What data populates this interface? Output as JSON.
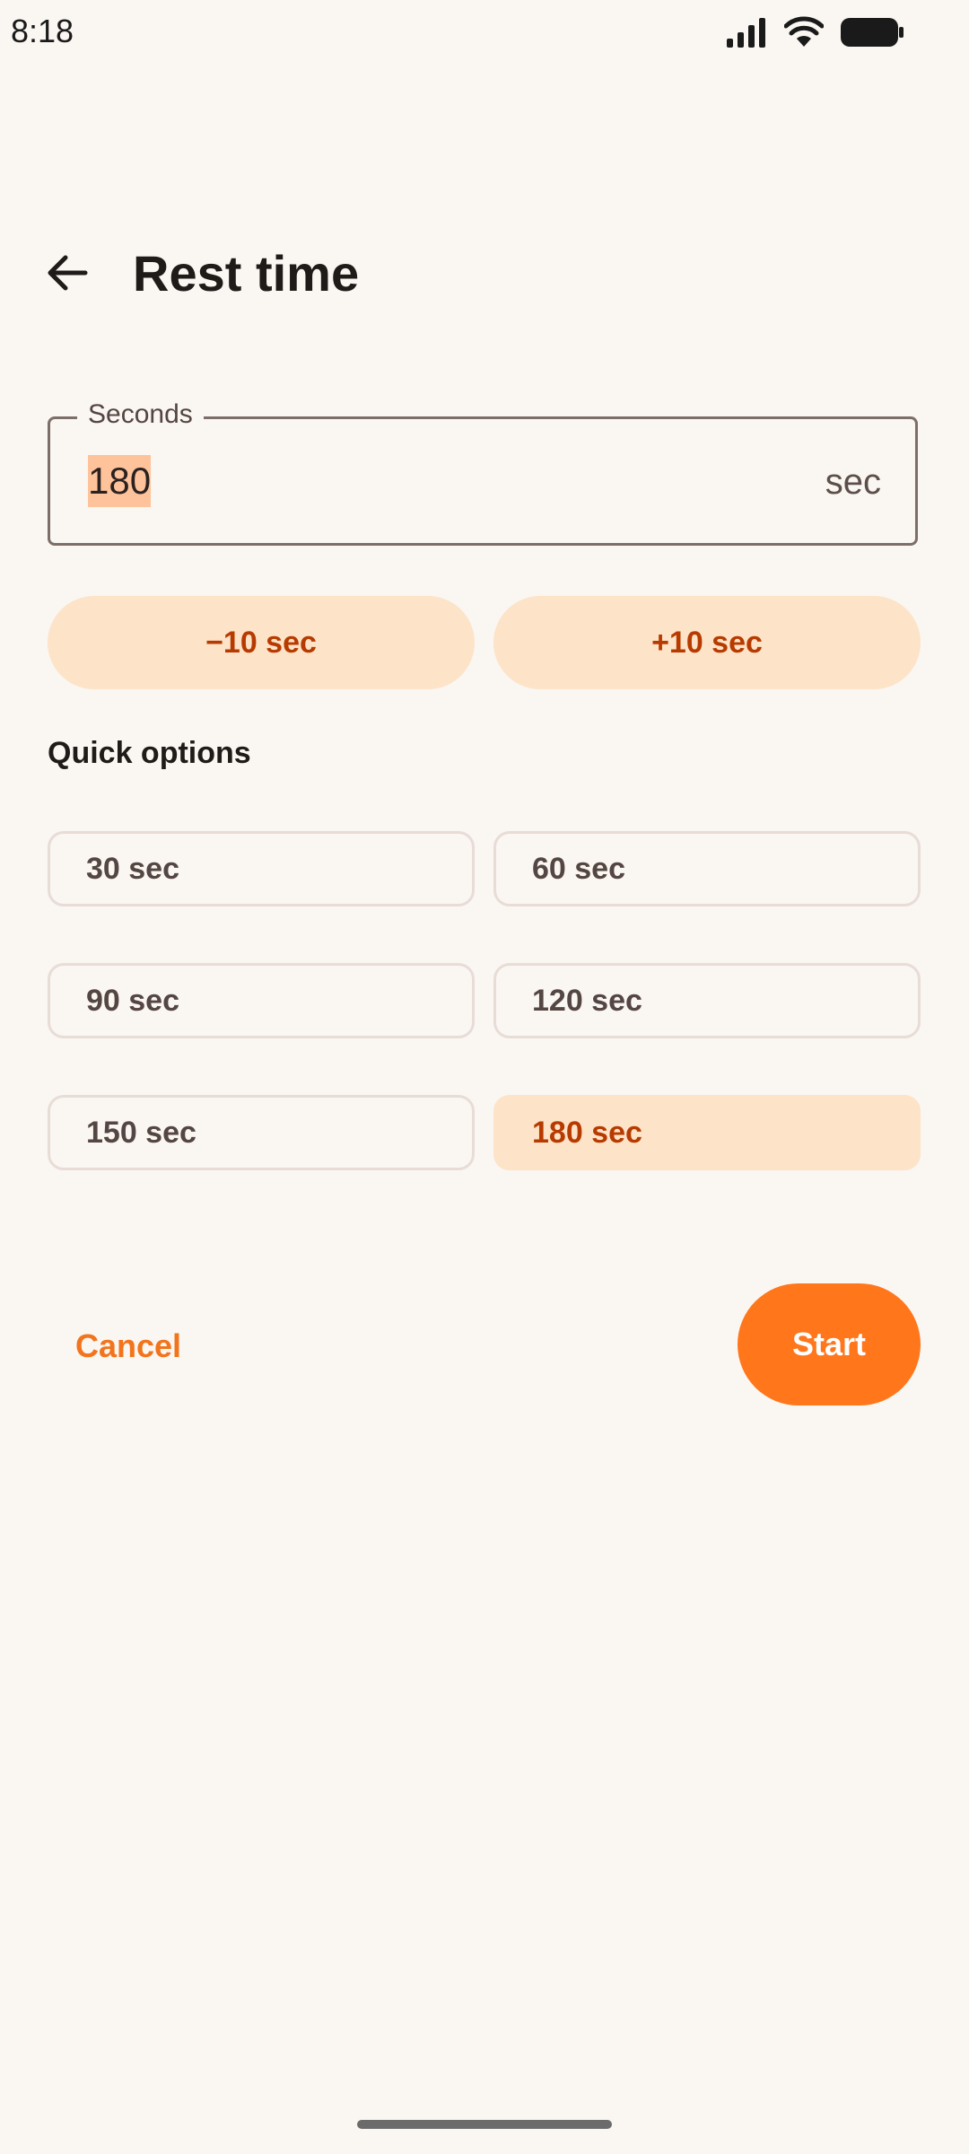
{
  "status_bar": {
    "time": "8:18",
    "icons": [
      "signal-icon",
      "wifi-icon",
      "battery-icon"
    ]
  },
  "header": {
    "back_icon": "arrow-back-icon",
    "title": "Rest time"
  },
  "seconds_field": {
    "label": "Seconds",
    "value": "180",
    "suffix": "sec"
  },
  "steppers": {
    "minus_label": "−10 sec",
    "plus_label": "+10 sec"
  },
  "quick_options": {
    "title": "Quick options",
    "options": [
      {
        "label": "30 sec",
        "selected": false
      },
      {
        "label": "60 sec",
        "selected": false
      },
      {
        "label": "90 sec",
        "selected": false
      },
      {
        "label": "120 sec",
        "selected": false
      },
      {
        "label": "150 sec",
        "selected": false
      },
      {
        "label": "180 sec",
        "selected": true
      }
    ]
  },
  "actions": {
    "cancel_label": "Cancel",
    "start_label": "Start"
  },
  "colors": {
    "background": "#FAF6F2",
    "accent": "#FF761B",
    "tonal_container": "#FDE3C8",
    "on_tonal": "#B73B00",
    "selection_highlight": "#FFC39B"
  }
}
